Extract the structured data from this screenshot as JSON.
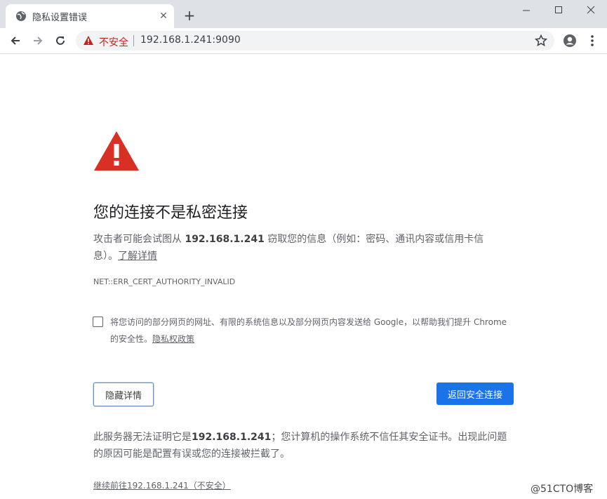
{
  "browser": {
    "tab_title": "隐私设置错误",
    "tab_close": "✕",
    "new_tab": "+",
    "not_secure": "不安全",
    "url": "192.168.1.241:9090"
  },
  "page": {
    "heading": "您的连接不是私密连接",
    "desc_prefix": "攻击者可能会试图从 ",
    "desc_host": "192.168.1.241",
    "desc_suffix": " 窃取您的信息（例如：密码、通讯内容或信用卡信息）。",
    "learn_more": "了解详情",
    "error_code": "NET::ERR_CERT_AUTHORITY_INVALID",
    "checkbox_text": "将您访问的部分网页的网址、有限的系统信息以及部分网页内容发送给 Google，以帮助我们提升 Chrome 的安全性。",
    "privacy_policy": "隐私权政策",
    "hide_details": "隐藏详情",
    "back_to_safety": "返回安全连接",
    "details_prefix": "此服务器无法证明它是",
    "details_host": "192.168.1.241",
    "details_suffix": "；您计算机的操作系统不信任其安全证书。出现此问题的原因可能是配置有误或您的连接被拦截了。",
    "proceed_link": "继续前往192.168.1.241（不安全）"
  },
  "watermark": "@51CTO博客",
  "colors": {
    "warning_red": "#d93025",
    "primary_blue": "#1a73e8"
  }
}
